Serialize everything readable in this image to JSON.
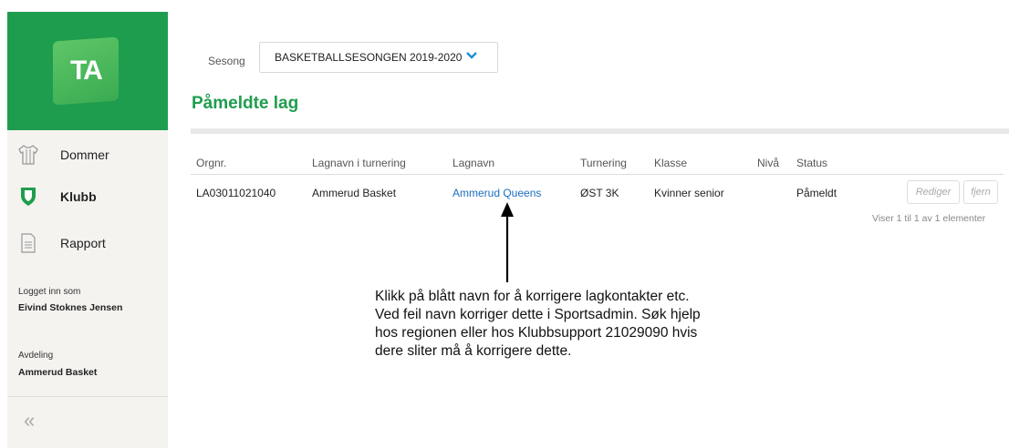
{
  "sidebar": {
    "logo_text": "TA",
    "logo_color": "#1f9d4e",
    "items": [
      {
        "label": "Dommer",
        "icon": "referee-shirt-icon"
      },
      {
        "label": "Klubb",
        "icon": "shield-icon",
        "active": true
      },
      {
        "label": "Rapport",
        "icon": "document-icon"
      }
    ],
    "logged_in_label": "Logget inn som",
    "logged_in_user": "Eivind Stoknes Jensen",
    "department_label": "Avdeling",
    "department_value": "Ammerud Basket",
    "collapse_icon": "«"
  },
  "season": {
    "label": "Sesong",
    "selected": "BASKETBALLSESONGEN 2019-2020"
  },
  "page_title": "Påmeldte lag",
  "table": {
    "columns": [
      "Orgnr.",
      "Lagnavn i turnering",
      "Lagnavn",
      "Turnering",
      "Klasse",
      "Nivå",
      "Status"
    ],
    "rows": [
      {
        "orgnr": "LA03011021040",
        "lagnavn_turnering": "Ammerud Basket",
        "lagnavn": "Ammerud Queens",
        "turnering": "ØST 3K",
        "klasse": "Kvinner senior",
        "niva": "",
        "status": "Påmeldt",
        "edit_label": "Rediger",
        "remove_label": "fjern"
      }
    ],
    "pager_text": "Viser 1 til 1 av 1 elementer"
  },
  "annotation": {
    "lines": [
      "Klikk på blått navn for å korrigere lagkontakter etc.",
      "Ved feil navn korriger dette i Sportsadmin. Søk hjelp",
      "hos regionen eller hos Klubbsupport 21029090 hvis",
      "dere sliter må å korrigere dette."
    ]
  },
  "colors": {
    "accent_green": "#1f9d4e",
    "link_blue": "#1a6fc0",
    "chevron_blue": "#1a8fd8"
  }
}
